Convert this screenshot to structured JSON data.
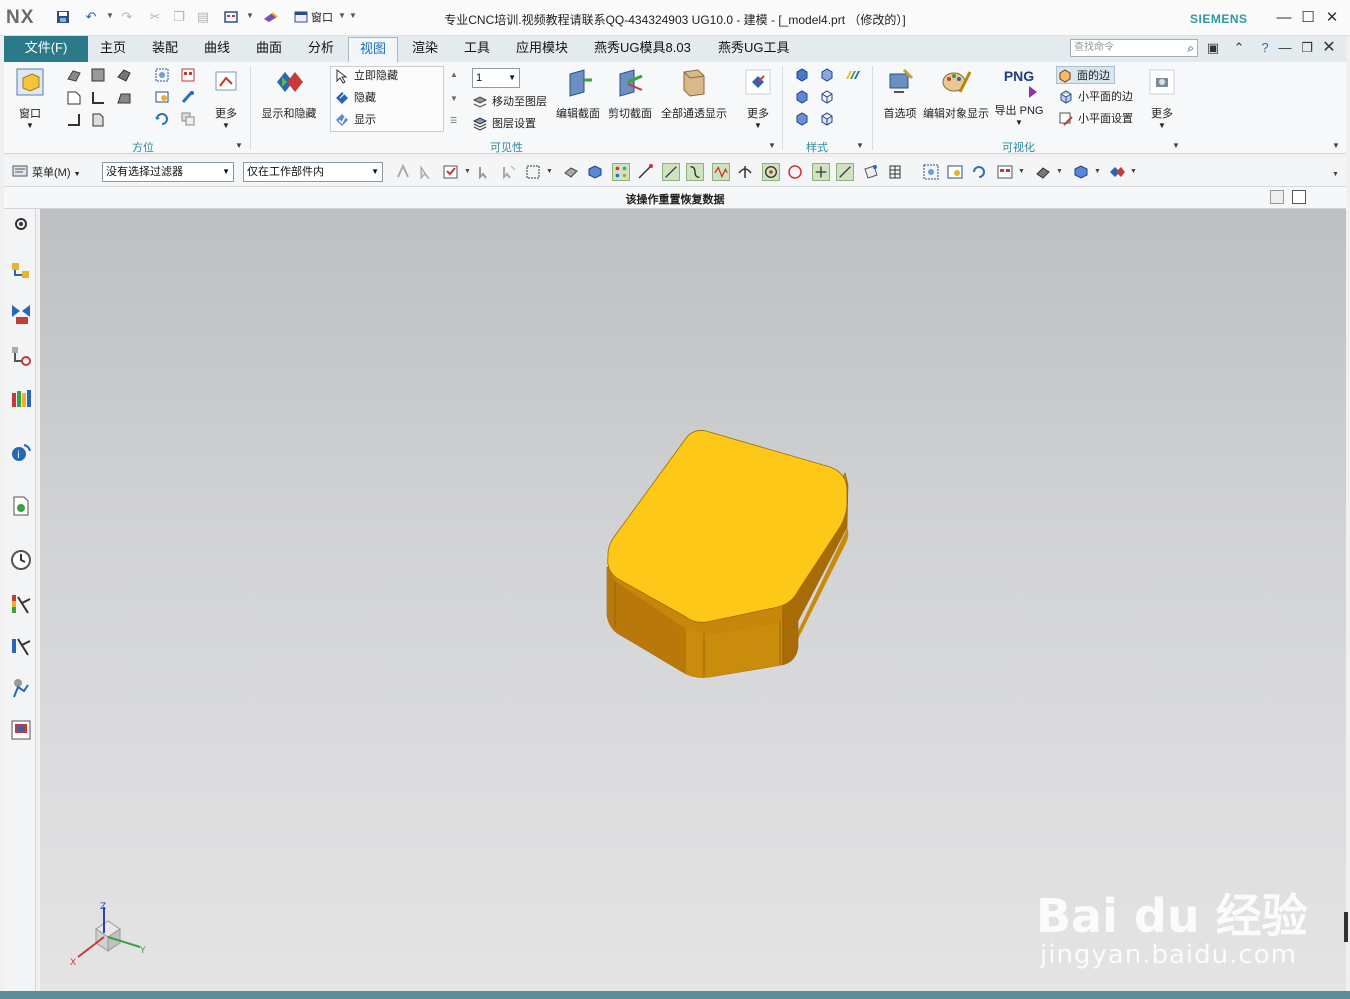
{
  "titlebar": {
    "logo": "NX",
    "window_menu": "窗口",
    "title": "专业CNC培训.视频教程请联系QQ-434324903 UG10.0 - 建模 - [_model4.prt （修改的）]",
    "brand": "SIEMENS"
  },
  "tabs": {
    "file": "文件(F)",
    "items": [
      "主页",
      "装配",
      "曲线",
      "曲面",
      "分析",
      "视图",
      "渲染",
      "工具",
      "应用模块",
      "燕秀UG模具8.03",
      "燕秀UG工具"
    ],
    "active": "视图",
    "search_placeholder": "查找命令"
  },
  "ribbon": {
    "window_btn": "窗口",
    "orient_more": "更多",
    "orient_group": "方位",
    "show_hide_btn": "显示和隐藏",
    "immediate_hide": "立即隐藏",
    "hide": "隐藏",
    "show": "显示",
    "layer_value": "1",
    "move_to_layer": "移动至图层",
    "layer_settings": "图层设置",
    "visibility_group": "可见性",
    "edit_section": "编辑截面",
    "clip_section": "剪切截面",
    "all_through": "全部通透显示",
    "section_more": "更多",
    "style_group": "样式",
    "preferences": "首选项",
    "edit_object_display": "编辑对象显示",
    "export_png_label": "PNG",
    "export_png": "导出 PNG",
    "face_edges": "面的边",
    "small_face_edges": "小平面的边",
    "small_face_settings": "小平面设置",
    "visualize_more": "更多",
    "visualize_group": "可视化"
  },
  "seltoolbar": {
    "menu": "菜单(M)",
    "filter": "没有选择过滤器",
    "scope": "仅在工作部件内"
  },
  "status": {
    "message": "该操作重置恢复数据"
  },
  "triad": {
    "x": "X",
    "y": "Y",
    "z": "Z"
  },
  "watermark": {
    "logo": "Bai du 经验",
    "url": "jingyan.baidu.com"
  },
  "colors": {
    "part_top": "#fdc818",
    "part_side": "#c88a08",
    "tab_bar": "#5b97aa",
    "file_tab": "#2b7a8a",
    "accent": "#2a8aa0"
  }
}
